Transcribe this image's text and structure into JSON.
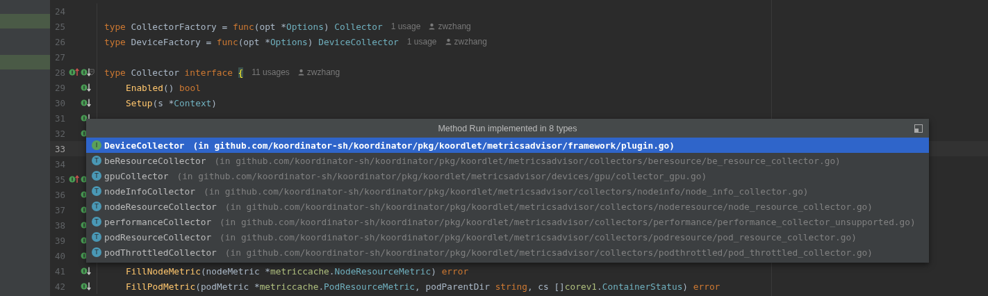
{
  "editor": {
    "lines": [
      {
        "number": "24",
        "current": false,
        "fold": false,
        "super_mark": false,
        "impl_mark": false
      },
      {
        "number": "25",
        "current": false,
        "fold": false,
        "super_mark": false,
        "impl_mark": false,
        "tokens": [
          {
            "kind": "keyword",
            "text": "type"
          },
          {
            "kind": "plain",
            "text": " CollectorFactory = "
          },
          {
            "kind": "keyword",
            "text": "func"
          },
          {
            "kind": "plain",
            "text": "(opt *"
          },
          {
            "kind": "type",
            "text": "Options"
          },
          {
            "kind": "plain",
            "text": ") "
          },
          {
            "kind": "type",
            "text": "Collector"
          }
        ],
        "hints": [
          {
            "kind": "usages",
            "text": "1 usage"
          },
          {
            "kind": "author",
            "text": "zwzhang"
          }
        ]
      },
      {
        "number": "26",
        "current": false,
        "fold": false,
        "super_mark": false,
        "impl_mark": false,
        "tokens": [
          {
            "kind": "keyword",
            "text": "type"
          },
          {
            "kind": "plain",
            "text": " DeviceFactory = "
          },
          {
            "kind": "keyword",
            "text": "func"
          },
          {
            "kind": "plain",
            "text": "(opt *"
          },
          {
            "kind": "type",
            "text": "Options"
          },
          {
            "kind": "plain",
            "text": ") "
          },
          {
            "kind": "type",
            "text": "DeviceCollector"
          }
        ],
        "hints": [
          {
            "kind": "usages",
            "text": "1 usage"
          },
          {
            "kind": "author",
            "text": "zwzhang"
          }
        ]
      },
      {
        "number": "27",
        "current": false,
        "fold": false,
        "super_mark": false,
        "impl_mark": false
      },
      {
        "number": "28",
        "current": false,
        "fold": true,
        "super_mark": true,
        "impl_mark": true,
        "tokens": [
          {
            "kind": "keyword",
            "text": "type"
          },
          {
            "kind": "plain",
            "text": " Collector "
          },
          {
            "kind": "keyword",
            "text": "interface"
          },
          {
            "kind": "brace",
            "text": "{"
          }
        ],
        "hints": [
          {
            "kind": "usages",
            "text": "11 usages"
          },
          {
            "kind": "author",
            "text": "zwzhang"
          }
        ],
        "children": [
          {
            "number": "29",
            "current": false,
            "fold": false,
            "super_mark": false,
            "impl_mark": true,
            "tokens": [
              {
                "kind": "function",
                "text": "Enabled"
              },
              {
                "kind": "plain",
                "text": "() "
              },
              {
                "kind": "keyword",
                "text": "bool"
              }
            ]
          },
          {
            "number": "30",
            "current": false,
            "fold": false,
            "super_mark": false,
            "impl_mark": true,
            "tokens": [
              {
                "kind": "function",
                "text": "Setup"
              },
              {
                "kind": "plain",
                "text": "(s *"
              },
              {
                "kind": "type",
                "text": "Context"
              },
              {
                "kind": "plain",
                "text": ")"
              }
            ]
          },
          {
            "number": "31",
            "current": false,
            "fold": false,
            "super_mark": false,
            "impl_mark": true
          },
          {
            "number": "32",
            "current": false,
            "fold": false,
            "super_mark": false,
            "impl_mark": true
          },
          {
            "number": "33",
            "current": true,
            "fold": false,
            "super_mark": false,
            "impl_mark": false
          },
          {
            "number": "34",
            "current": false,
            "fold": false,
            "super_mark": false,
            "impl_mark": false
          },
          {
            "number": "35",
            "current": false,
            "fold": false,
            "super_mark": true,
            "impl_mark": true
          },
          {
            "number": "36",
            "current": false,
            "fold": false,
            "super_mark": false,
            "impl_mark": true
          },
          {
            "number": "37",
            "current": false,
            "fold": false,
            "super_mark": false,
            "impl_mark": true
          },
          {
            "number": "38",
            "current": false,
            "fold": false,
            "super_mark": false,
            "impl_mark": true
          },
          {
            "number": "39",
            "current": false,
            "fold": false,
            "super_mark": false,
            "impl_mark": true
          },
          {
            "number": "40",
            "current": false,
            "fold": false,
            "super_mark": false,
            "impl_mark": true
          },
          {
            "number": "41",
            "current": false,
            "fold": false,
            "super_mark": false,
            "impl_mark": true,
            "tokens": [
              {
                "kind": "function",
                "text": "FillNodeMetric"
              },
              {
                "kind": "plain",
                "text": "(nodeMetric *"
              },
              {
                "kind": "package",
                "text": "metriccache"
              },
              {
                "kind": "plain",
                "text": "."
              },
              {
                "kind": "type",
                "text": "NodeResourceMetric"
              },
              {
                "kind": "plain",
                "text": ") "
              },
              {
                "kind": "keyword",
                "text": "error"
              }
            ]
          },
          {
            "number": "42",
            "current": false,
            "fold": false,
            "super_mark": false,
            "impl_mark": true,
            "tokens": [
              {
                "kind": "function",
                "text": "FillPodMetric"
              },
              {
                "kind": "plain",
                "text": "(podMetric *"
              },
              {
                "kind": "package",
                "text": "metriccache"
              },
              {
                "kind": "plain",
                "text": "."
              },
              {
                "kind": "type",
                "text": "PodResourceMetric"
              },
              {
                "kind": "plain",
                "text": ", podParentDir "
              },
              {
                "kind": "keyword",
                "text": "string"
              },
              {
                "kind": "plain",
                "text": ", cs []"
              },
              {
                "kind": "package",
                "text": "corev1"
              },
              {
                "kind": "plain",
                "text": "."
              },
              {
                "kind": "type",
                "text": "ContainerStatus"
              },
              {
                "kind": "plain",
                "text": ") "
              },
              {
                "kind": "keyword",
                "text": "error"
              }
            ]
          }
        ]
      }
    ]
  },
  "popup": {
    "title": "Method Run implemented in 8 types",
    "items": [
      {
        "kind": "interface",
        "badge": "I",
        "name": "DeviceCollector",
        "location": "(in github.com/koordinator-sh/koordinator/pkg/koordlet/metricsadvisor/framework/plugin.go)",
        "selected": true
      },
      {
        "kind": "type",
        "badge": "T",
        "name": "beResourceCollector",
        "location": "(in github.com/koordinator-sh/koordinator/pkg/koordlet/metricsadvisor/collectors/beresource/be_resource_collector.go)",
        "selected": false
      },
      {
        "kind": "type",
        "badge": "T",
        "name": "gpuCollector",
        "location": "(in github.com/koordinator-sh/koordinator/pkg/koordlet/metricsadvisor/devices/gpu/collector_gpu.go)",
        "selected": false
      },
      {
        "kind": "type",
        "badge": "T",
        "name": "nodeInfoCollector",
        "location": "(in github.com/koordinator-sh/koordinator/pkg/koordlet/metricsadvisor/collectors/nodeinfo/node_info_collector.go)",
        "selected": false
      },
      {
        "kind": "type",
        "badge": "T",
        "name": "nodeResourceCollector",
        "location": "(in github.com/koordinator-sh/koordinator/pkg/koordlet/metricsadvisor/collectors/noderesource/node_resource_collector.go)",
        "selected": false
      },
      {
        "kind": "type",
        "badge": "T",
        "name": "performanceCollector",
        "location": "(in github.com/koordinator-sh/koordinator/pkg/koordlet/metricsadvisor/collectors/performance/performance_collector_unsupported.go)",
        "selected": false
      },
      {
        "kind": "type",
        "badge": "T",
        "name": "podResourceCollector",
        "location": "(in github.com/koordinator-sh/koordinator/pkg/koordlet/metricsadvisor/collectors/podresource/pod_resource_collector.go)",
        "selected": false
      },
      {
        "kind": "type",
        "badge": "T",
        "name": "podThrottledCollector",
        "location": "(in github.com/koordinator-sh/koordinator/pkg/koordlet/metricsadvisor/collectors/podthrottled/pod_throttled_collector.go)",
        "selected": false
      }
    ]
  }
}
